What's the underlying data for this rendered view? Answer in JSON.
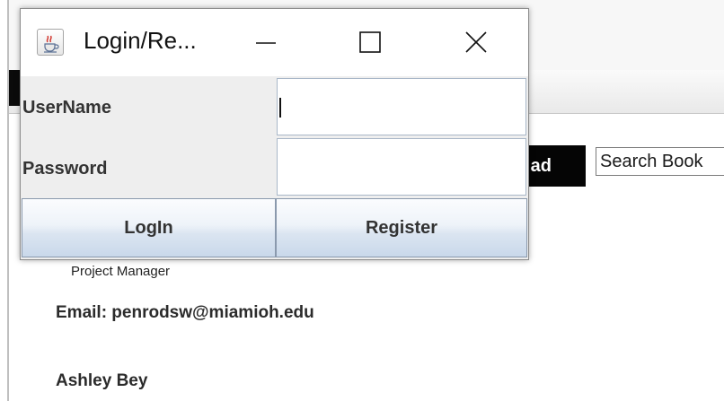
{
  "background_app": {
    "upload_label": "ad",
    "search": {
      "value": "Search Book",
      "placeholder": ""
    },
    "member": {
      "role": "Project Manager",
      "email": "Email: penrodsw@miamioh.edu",
      "next_name": "Ashley Bey"
    }
  },
  "dialog": {
    "title": "Login/Re...",
    "icon": "java-cup-icon",
    "window_controls": {
      "minimize": "minimize-icon",
      "maximize": "maximize-icon",
      "close": "close-icon"
    },
    "fields": {
      "username_label": "UserName",
      "username_value": "",
      "password_label": "Password",
      "password_value": ""
    },
    "buttons": {
      "login": "LogIn",
      "register": "Register"
    }
  },
  "colors": {
    "button_gradient_top": "#fbfcfe",
    "button_gradient_bottom": "#c9d8ea",
    "dialog_background": "#eeeeee",
    "background_button": "#050505"
  }
}
